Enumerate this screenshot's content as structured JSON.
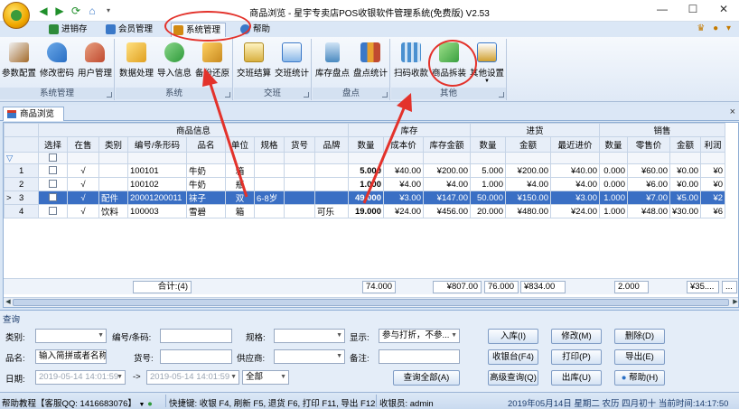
{
  "window": {
    "title": "商品浏览 - 星宇专卖店POS收银软件管理系统(免费版) V2.53"
  },
  "tabs": [
    {
      "label": "进销存",
      "color": "#2e8b3a"
    },
    {
      "label": "会员管理",
      "color": "#3a78c8"
    },
    {
      "label": "系统管理",
      "color": "#d28a12"
    },
    {
      "label": "帮助",
      "color": "#3a78c8"
    }
  ],
  "tab_right": "♛ ● ▾",
  "ribbon": {
    "groups": [
      {
        "label": "系统管理",
        "buttons": [
          {
            "label": "参数配置",
            "icon": "settings-icon",
            "color": "#a36a2a"
          },
          {
            "label": "修改密码",
            "icon": "key-icon",
            "color": "#2a6fc4"
          },
          {
            "label": "用户管理",
            "icon": "users-icon",
            "color": "#c04a30"
          }
        ]
      },
      {
        "label": "系统",
        "buttons": [
          {
            "label": "数据处理",
            "icon": "database-icon",
            "color": "#e0a020"
          },
          {
            "label": "导入信息",
            "icon": "import-icon",
            "color": "#2e9a3a"
          },
          {
            "label": "备份还原",
            "icon": "backup-icon",
            "color": "#c88a20"
          }
        ]
      },
      {
        "label": "交班",
        "buttons": [
          {
            "label": "交班结算",
            "icon": "shift-icon",
            "color": "#d8b040"
          },
          {
            "label": "交班统计",
            "icon": "stats-icon",
            "color": "#3a78c8"
          }
        ]
      },
      {
        "label": "盘点",
        "buttons": [
          {
            "label": "库存盘点",
            "icon": "calculator-icon",
            "color": "#4a8ac0"
          },
          {
            "label": "盘点统计",
            "icon": "chart-icon",
            "color": "#3a78c8"
          }
        ]
      },
      {
        "label": "其他",
        "buttons": [
          {
            "label": "扫码收款",
            "icon": "qr-icon",
            "color": "#4a90d0"
          },
          {
            "label": "商品拆装",
            "icon": "package-icon",
            "color": "#3aa040"
          },
          {
            "label": "其他设置",
            "icon": "other-settings-icon",
            "color": "#d0a030"
          }
        ]
      }
    ]
  },
  "doc_tab": "商品浏览",
  "doc_close": "×",
  "grid": {
    "groups": {
      "info": "商品信息",
      "stock": "库存",
      "purchase": "进货",
      "sales": "销售"
    },
    "headers": [
      "选择",
      "在售",
      "类别",
      "编号/条形码",
      "品名",
      "单位",
      "规格",
      "货号",
      "品牌",
      "数量",
      "成本价",
      "库存金额",
      "数量",
      "金额",
      "最近进价",
      "数量",
      "零售价",
      "金额",
      "利润"
    ],
    "rows": [
      {
        "no": "1",
        "onsale": "√",
        "category": "",
        "code": "100101",
        "name": "牛奶",
        "unit": "箱",
        "spec": "",
        "itemno": "",
        "brand": "",
        "stock_qty": "5.000",
        "cost": "¥40.00",
        "stock_amt": "¥200.00",
        "pur_qty": "5.000",
        "pur_amt": "¥200.00",
        "last_price": "¥40.00",
        "sale_qty": "0.000",
        "retail": "¥60.00",
        "sale_amt": "¥0.00",
        "profit": "¥0"
      },
      {
        "no": "2",
        "onsale": "√",
        "category": "",
        "code": "100102",
        "name": "牛奶",
        "unit": "瓶",
        "spec": "",
        "itemno": "",
        "brand": "",
        "stock_qty": "1.000",
        "cost": "¥4.00",
        "stock_amt": "¥4.00",
        "pur_qty": "1.000",
        "pur_amt": "¥4.00",
        "last_price": "¥4.00",
        "sale_qty": "0.000",
        "retail": "¥6.00",
        "sale_amt": "¥0.00",
        "profit": "¥0"
      },
      {
        "no": "3",
        "onsale": "√",
        "category": "配件",
        "code": "20001200011",
        "name": "袜子",
        "unit": "双",
        "spec": "6-8岁",
        "itemno": "",
        "brand": "",
        "stock_qty": "49.000",
        "cost": "¥3.00",
        "stock_amt": "¥147.00",
        "pur_qty": "50.000",
        "pur_amt": "¥150.00",
        "last_price": "¥3.00",
        "sale_qty": "1.000",
        "retail": "¥7.00",
        "sale_amt": "¥5.00",
        "profit": "¥2"
      },
      {
        "no": "4",
        "onsale": "√",
        "category": "饮料",
        "code": "100003",
        "name": "雪碧",
        "unit": "箱",
        "spec": "",
        "itemno": "",
        "brand": "可乐",
        "stock_qty": "19.000",
        "cost": "¥24.00",
        "stock_amt": "¥456.00",
        "pur_qty": "20.000",
        "pur_amt": "¥480.00",
        "last_price": "¥24.00",
        "sale_qty": "1.000",
        "retail": "¥48.00",
        "sale_amt": "¥30.00",
        "profit": "¥6"
      }
    ],
    "selected_row": 2,
    "row_marker": ">",
    "filter_icon": "▽",
    "summary": {
      "label": "合计:(4)",
      "stock_qty": "74.000",
      "stock_amt": "¥807.00",
      "pur_qty": "76.000",
      "pur_amt": "¥834.00",
      "sale_qty": "2.000",
      "sale_amt": "¥35....",
      "more": "..."
    }
  },
  "query": {
    "title": "查询",
    "labels": {
      "category": "类别:",
      "code": "编号/条码:",
      "spec": "规格:",
      "display": "显示:",
      "name": "品名:",
      "itemno": "货号:",
      "supplier": "供应商:",
      "remark": "备注:",
      "date": "日期:",
      "to": "->"
    },
    "values": {
      "category": "",
      "code": "",
      "spec": "",
      "display": "参与打折，不参...",
      "name": "输入简拼或者名称",
      "itemno": "",
      "supplier": "",
      "remark": "",
      "date_from": "2019-05-14 14:01:59",
      "date_to": "2019-05-14 14:01:59",
      "date_range": "全部"
    },
    "buttons": {
      "query_all": "查询全部(A)",
      "stock_in": "入库(I)",
      "modify": "修改(M)",
      "delete": "删除(D)",
      "cashier": "收银台(F4)",
      "print": "打印(P)",
      "export": "导出(E)",
      "advanced": "高级查询(Q)",
      "stock_out": "出库(U)",
      "help": "帮助(H)"
    }
  },
  "status": {
    "help": "帮助教程【客服QQ: 1416683076】",
    "shortcuts": "快捷键: 收银 F4, 刷新 F5, 退货 F6, 打印 F11, 导出 F12",
    "cashier": "收银员: admin",
    "datetime": "2019年05月14日 星期二 农历 四月初十 当前时间:14:17:50"
  },
  "colors": {
    "annotation": "#e3322b",
    "selection": "#3a6fc4",
    "accent": "#2a6fc4"
  }
}
